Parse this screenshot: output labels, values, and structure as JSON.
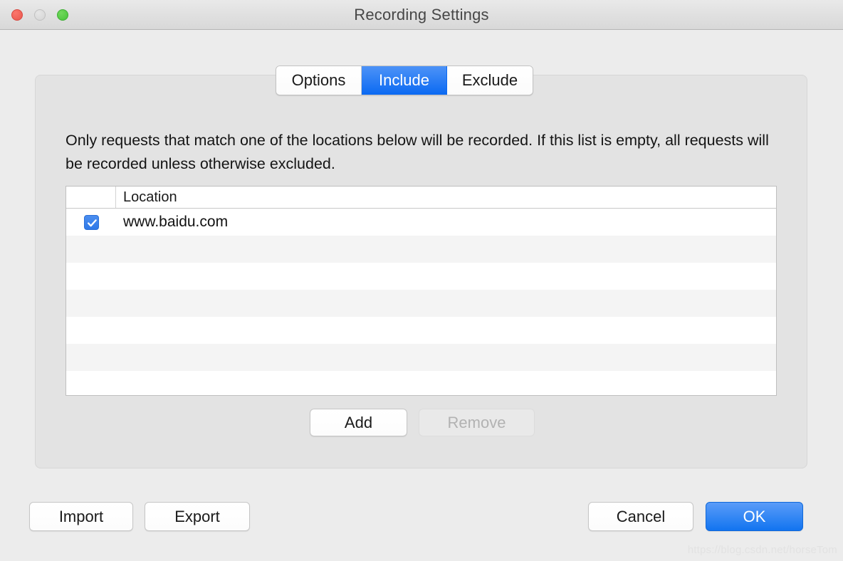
{
  "window": {
    "title": "Recording Settings",
    "traffic_lights": [
      {
        "name": "close",
        "color": "#e9574d",
        "enabled": true
      },
      {
        "name": "minimize",
        "color": "#d4d4d4",
        "enabled": false
      },
      {
        "name": "maximize",
        "color": "#47c33a",
        "enabled": true
      }
    ]
  },
  "tabs": {
    "items": [
      {
        "label": "Options",
        "selected": false
      },
      {
        "label": "Include",
        "selected": true
      },
      {
        "label": "Exclude",
        "selected": false
      }
    ],
    "selected_color": "#0a69f2"
  },
  "panel": {
    "description": "Only requests that match one of the locations below will be recorded. If this list is empty, all requests will be recorded unless otherwise excluded."
  },
  "table": {
    "columns": [
      "",
      "Location"
    ],
    "header_location": "Location",
    "rows": [
      {
        "checked": true,
        "location": "www.baidu.com"
      },
      {
        "checked": false,
        "location": ""
      },
      {
        "checked": false,
        "location": ""
      },
      {
        "checked": false,
        "location": ""
      },
      {
        "checked": false,
        "location": ""
      },
      {
        "checked": false,
        "location": ""
      },
      {
        "checked": false,
        "location": ""
      }
    ]
  },
  "list_actions": {
    "add_label": "Add",
    "add_enabled": true,
    "remove_label": "Remove",
    "remove_enabled": false
  },
  "footer": {
    "import_label": "Import",
    "export_label": "Export",
    "cancel_label": "Cancel",
    "ok_label": "OK",
    "ok_accent_color": "#1274f0"
  },
  "watermark": {
    "text": "https://blog.csdn.net/horseTom"
  }
}
